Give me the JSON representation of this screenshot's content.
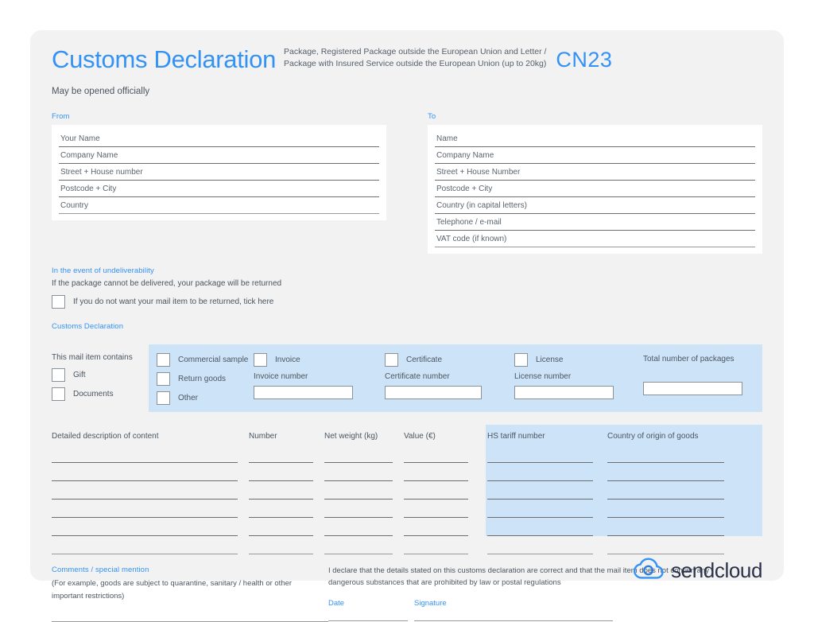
{
  "header": {
    "title": "Customs Declaration",
    "subtitle_line1": "Package, Registered Package outside the European Union and Letter /",
    "subtitle_line2": "Package with Insured Service outside the European Union (up to 20kg)",
    "form_code": "CN23",
    "may_be_opened": "May be opened officially"
  },
  "from": {
    "label": "From",
    "fields": [
      "Your Name",
      "Company Name",
      "Street + House number",
      "Postcode + City",
      "Country"
    ]
  },
  "to": {
    "label": "To",
    "fields": [
      "Name",
      "Company Name",
      "Street + House Number",
      "Postcode + City",
      "Country (in capital letters)",
      "Telephone / e-mail",
      "VAT code (if known)"
    ]
  },
  "undeliverability": {
    "label": "In the event of undeliverability",
    "note": "If the package cannot be delivered, your package will be returned",
    "checkbox_label": "If you do not want your mail item to be returned, tick here"
  },
  "customs_declaration": {
    "label": "Customs Declaration",
    "contains_hint": "This mail item contains",
    "contains_options": [
      "Gift",
      "Documents"
    ],
    "type_options": [
      "Commercial sample",
      "Return goods",
      "Other"
    ],
    "invoice": {
      "checkbox_label": "Invoice",
      "field_label": "Invoice number",
      "value": ""
    },
    "certificate": {
      "checkbox_label": "Certificate",
      "field_label": "Certificate number",
      "value": ""
    },
    "license": {
      "checkbox_label": "License",
      "field_label": "License number",
      "value": ""
    },
    "total_packages": {
      "field_label": "Total number of packages",
      "value": ""
    }
  },
  "goods_table": {
    "columns": [
      "Detailed description of content",
      "Number",
      "Net weight (kg)",
      "Value (€)",
      "HS tariff number",
      "Country of origin of goods"
    ],
    "row_count": 6,
    "rows": [
      [
        "",
        "",
        "",
        "",
        "",
        ""
      ],
      [
        "",
        "",
        "",
        "",
        "",
        ""
      ],
      [
        "",
        "",
        "",
        "",
        "",
        ""
      ],
      [
        "",
        "",
        "",
        "",
        "",
        ""
      ],
      [
        "",
        "",
        "",
        "",
        "",
        ""
      ],
      [
        "",
        "",
        "",
        "",
        "",
        ""
      ]
    ]
  },
  "comments": {
    "label": "Comments / special mention",
    "caption_line1": "(For example, goods are subject to quarantine, sanitary / health or other",
    "caption_line2": "important restrictions)",
    "value": ""
  },
  "declaration": {
    "text_line1": "I declare that the details stated on this customs declaration are correct and that the mail item does not contain any",
    "text_line2": "dangerous substances that are prohibited by law or postal regulations",
    "date_label": "Date",
    "date_value": "",
    "signature_label": "Signature",
    "signature_value": ""
  },
  "brand": {
    "name": "sendcloud"
  },
  "colors": {
    "accent_blue": "#3392f5",
    "panel_blue": "#cde4f8",
    "card_bg": "#f2f2f2",
    "text_gray": "#4b5560",
    "logo_navy": "#2b3249"
  }
}
